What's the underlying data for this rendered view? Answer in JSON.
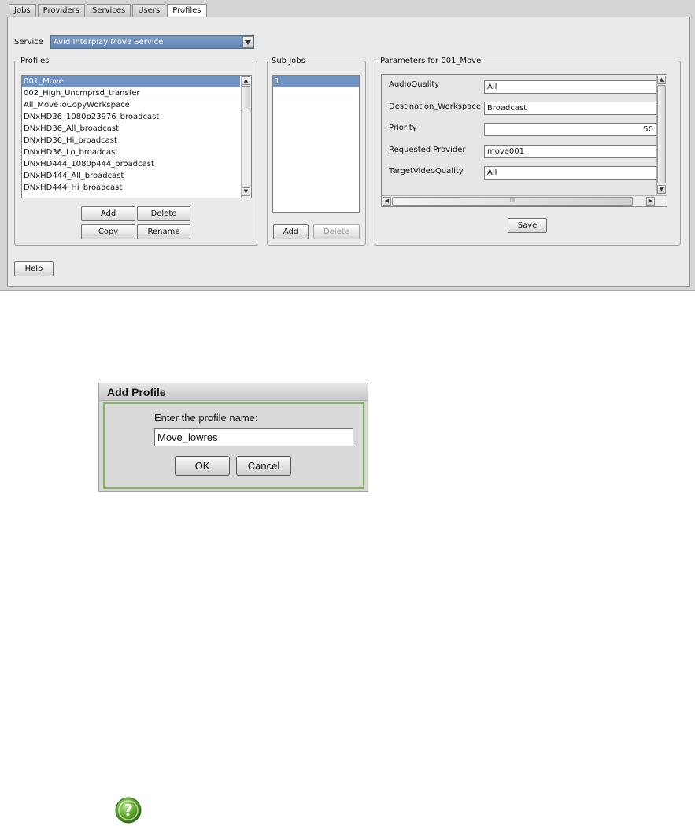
{
  "tabs": [
    "Jobs",
    "Providers",
    "Services",
    "Users",
    "Profiles"
  ],
  "active_tab": "Profiles",
  "service": {
    "label": "Service",
    "value": "Avid Interplay Move Service"
  },
  "profiles": {
    "label": "Profiles",
    "items": [
      "001_Move",
      "002_High_Uncmprsd_transfer",
      "All_MoveToCopyWorkspace",
      "DNxHD36_1080p23976_broadcast",
      "DNxHD36_All_broadcast",
      "DNxHD36_Hi_broadcast",
      "DNxHD36_Lo_broadcast",
      "DNxHD444_1080p444_broadcast",
      "DNxHD444_All_broadcast",
      "DNxHD444_Hi_broadcast"
    ],
    "selected": "001_Move",
    "buttons": {
      "add": "Add",
      "delete": "Delete",
      "copy": "Copy",
      "rename": "Rename"
    }
  },
  "subjobs": {
    "label": "Sub Jobs",
    "items": [
      "1"
    ],
    "buttons": {
      "add": "Add",
      "delete": "Delete"
    }
  },
  "parameters": {
    "label": "Parameters for 001_Move",
    "rows": [
      {
        "name": "AudioQuality",
        "value": "All"
      },
      {
        "name": "Destination_Workspace",
        "value": "Broadcast"
      },
      {
        "name": "Priority",
        "value": "50"
      },
      {
        "name": "Requested Provider",
        "value": "move001"
      },
      {
        "name": "TargetVideoQuality",
        "value": "All"
      }
    ],
    "save_label": "Save",
    "hscroll_grip": "III"
  },
  "help_label": "Help",
  "dialog": {
    "title": "Add Profile",
    "prompt": "Enter the profile name:",
    "input_value": "Move_lowres",
    "ok_label": "OK",
    "cancel_label": "Cancel",
    "icon": "question-icon",
    "icon_color": "#5aa52a"
  }
}
